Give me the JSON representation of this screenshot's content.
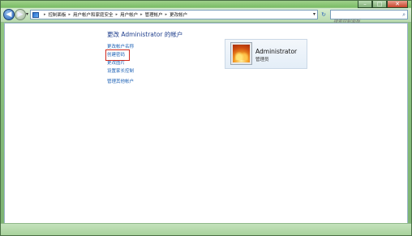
{
  "window": {
    "minimize_glyph": "–",
    "maximize_glyph": "□",
    "close_glyph": "✕"
  },
  "nav": {
    "back_glyph": "◀",
    "forward_glyph": "▶",
    "history_dropdown_glyph": "▾",
    "refresh_glyph": "↻"
  },
  "breadcrumb": {
    "separator": "▸",
    "items": [
      "控制面板",
      "用户帐户和家庭安全",
      "用户帐户",
      "管理帐户",
      "更改帐户"
    ],
    "dropdown_glyph": "▾"
  },
  "search": {
    "placeholder": "搜索控制面板",
    "icon": "search-icon"
  },
  "page": {
    "title": "更改 Administrator 的帐户"
  },
  "tasks": [
    {
      "label": "更改帐户名称",
      "highlighted": false
    },
    {
      "label": "创建密码",
      "highlighted": true
    },
    {
      "label": "更改图片",
      "highlighted": false
    },
    {
      "label": "设置家长控制",
      "highlighted": false
    },
    {
      "label": "管理其他帐户",
      "highlighted": false
    }
  ],
  "account": {
    "name": "Administrator",
    "role": "管理员",
    "avatar_icon": "flower-avatar-icon"
  },
  "colors": {
    "link": "#1a5fb4",
    "title": "#1e3e8c",
    "highlight_box": "#d12a1f"
  }
}
